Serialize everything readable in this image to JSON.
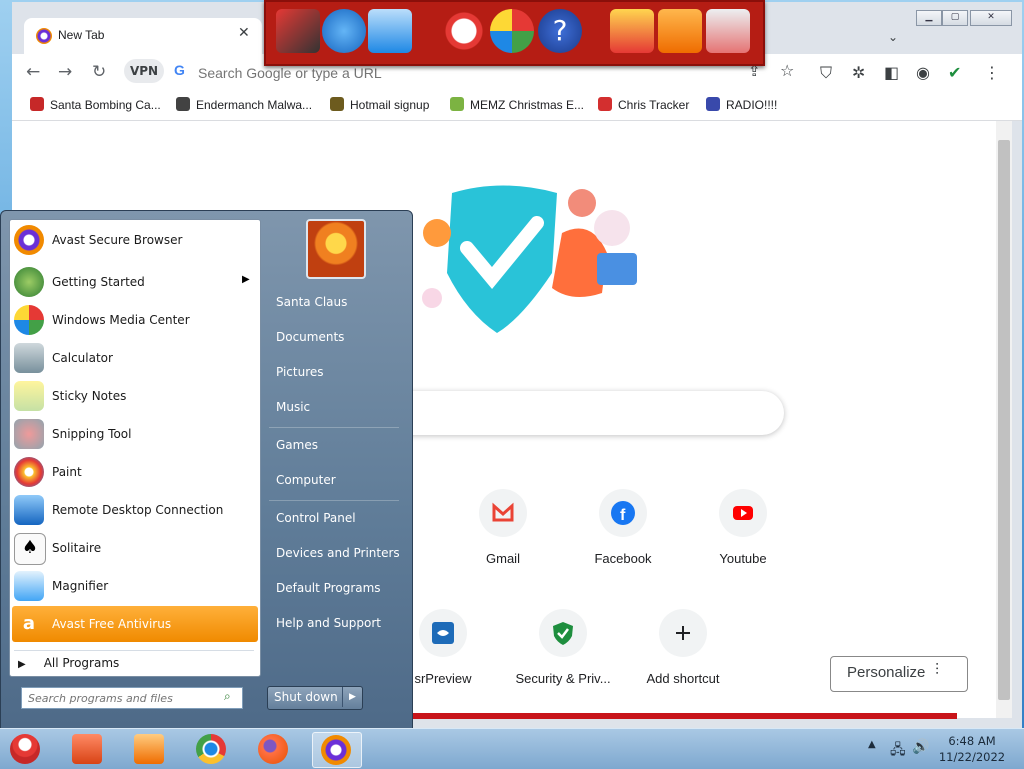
{
  "browser": {
    "tab_title": "New Tab",
    "tab_close": "✕",
    "vpn_label": "VPN",
    "omnibox_placeholder": "Search Google or type a URL",
    "google_letter": "G",
    "bookmarks": [
      {
        "label": "Santa Bombing Ca...",
        "icon": "santa-icon",
        "color": "#c62828"
      },
      {
        "label": "Endermanch Malwa...",
        "icon": "skull-icon",
        "color": "#424242"
      },
      {
        "label": "Hotmail signup",
        "icon": "person-icon",
        "color": "#6d5b1e"
      },
      {
        "label": "MEMZ Christmas E...",
        "icon": "globe-icon",
        "color": "#7cb342"
      },
      {
        "label": "Chris Tracker",
        "icon": "star-icon",
        "color": "#d32f2f"
      },
      {
        "label": "RADIO!!!!",
        "icon": "radio-icon",
        "color": "#3949ab"
      }
    ],
    "shortcuts_row1": [
      {
        "label": "Gmail",
        "icon": "gmail-icon"
      },
      {
        "label": "Facebook",
        "icon": "facebook-icon"
      },
      {
        "label": "Youtube",
        "icon": "youtube-icon"
      }
    ],
    "shortcuts_row2": [
      {
        "label": "srPreview",
        "icon": "srpreview-icon"
      },
      {
        "label": "Security & Priv...",
        "icon": "shield-icon"
      },
      {
        "label": "Add shortcut",
        "icon": "plus-icon"
      }
    ],
    "personalize_label": "Personalize"
  },
  "start_menu": {
    "programs": [
      {
        "label": "Avast Secure Browser",
        "icon": "avast-browser-icon"
      },
      {
        "label": "Getting Started",
        "icon": "getting-started-icon",
        "submenu": true
      },
      {
        "label": "Windows Media Center",
        "icon": "media-center-icon"
      },
      {
        "label": "Calculator",
        "icon": "calculator-icon"
      },
      {
        "label": "Sticky Notes",
        "icon": "sticky-notes-icon"
      },
      {
        "label": "Snipping Tool",
        "icon": "snipping-tool-icon"
      },
      {
        "label": "Paint",
        "icon": "paint-icon"
      },
      {
        "label": "Remote Desktop Connection",
        "icon": "remote-desktop-icon"
      },
      {
        "label": "Solitaire",
        "icon": "solitaire-icon"
      },
      {
        "label": "Magnifier",
        "icon": "magnifier-icon"
      },
      {
        "label": "Avast Free Antivirus",
        "icon": "avast-antivirus-icon",
        "highlighted": true
      }
    ],
    "all_programs": "All Programs",
    "search_placeholder": "Search programs and files",
    "right_items": [
      "Santa Claus",
      "Documents",
      "Pictures",
      "Music",
      "Games",
      "Computer",
      "Control Panel",
      "Devices and Printers",
      "Default Programs",
      "Help and Support"
    ],
    "shutdown_label": "Shut down"
  },
  "taskbar": {
    "apps": [
      "start-orb-santa-icon",
      "explorer-icon",
      "media-player-icon",
      "chrome-icon",
      "firefox-icon",
      "avast-browser-icon"
    ],
    "time": "6:48 AM",
    "date": "11/22/2022"
  },
  "colors": {
    "accent_orange": "#f08a00",
    "gadget_red": "#b51d14",
    "start_menu": "#5f7c98"
  }
}
